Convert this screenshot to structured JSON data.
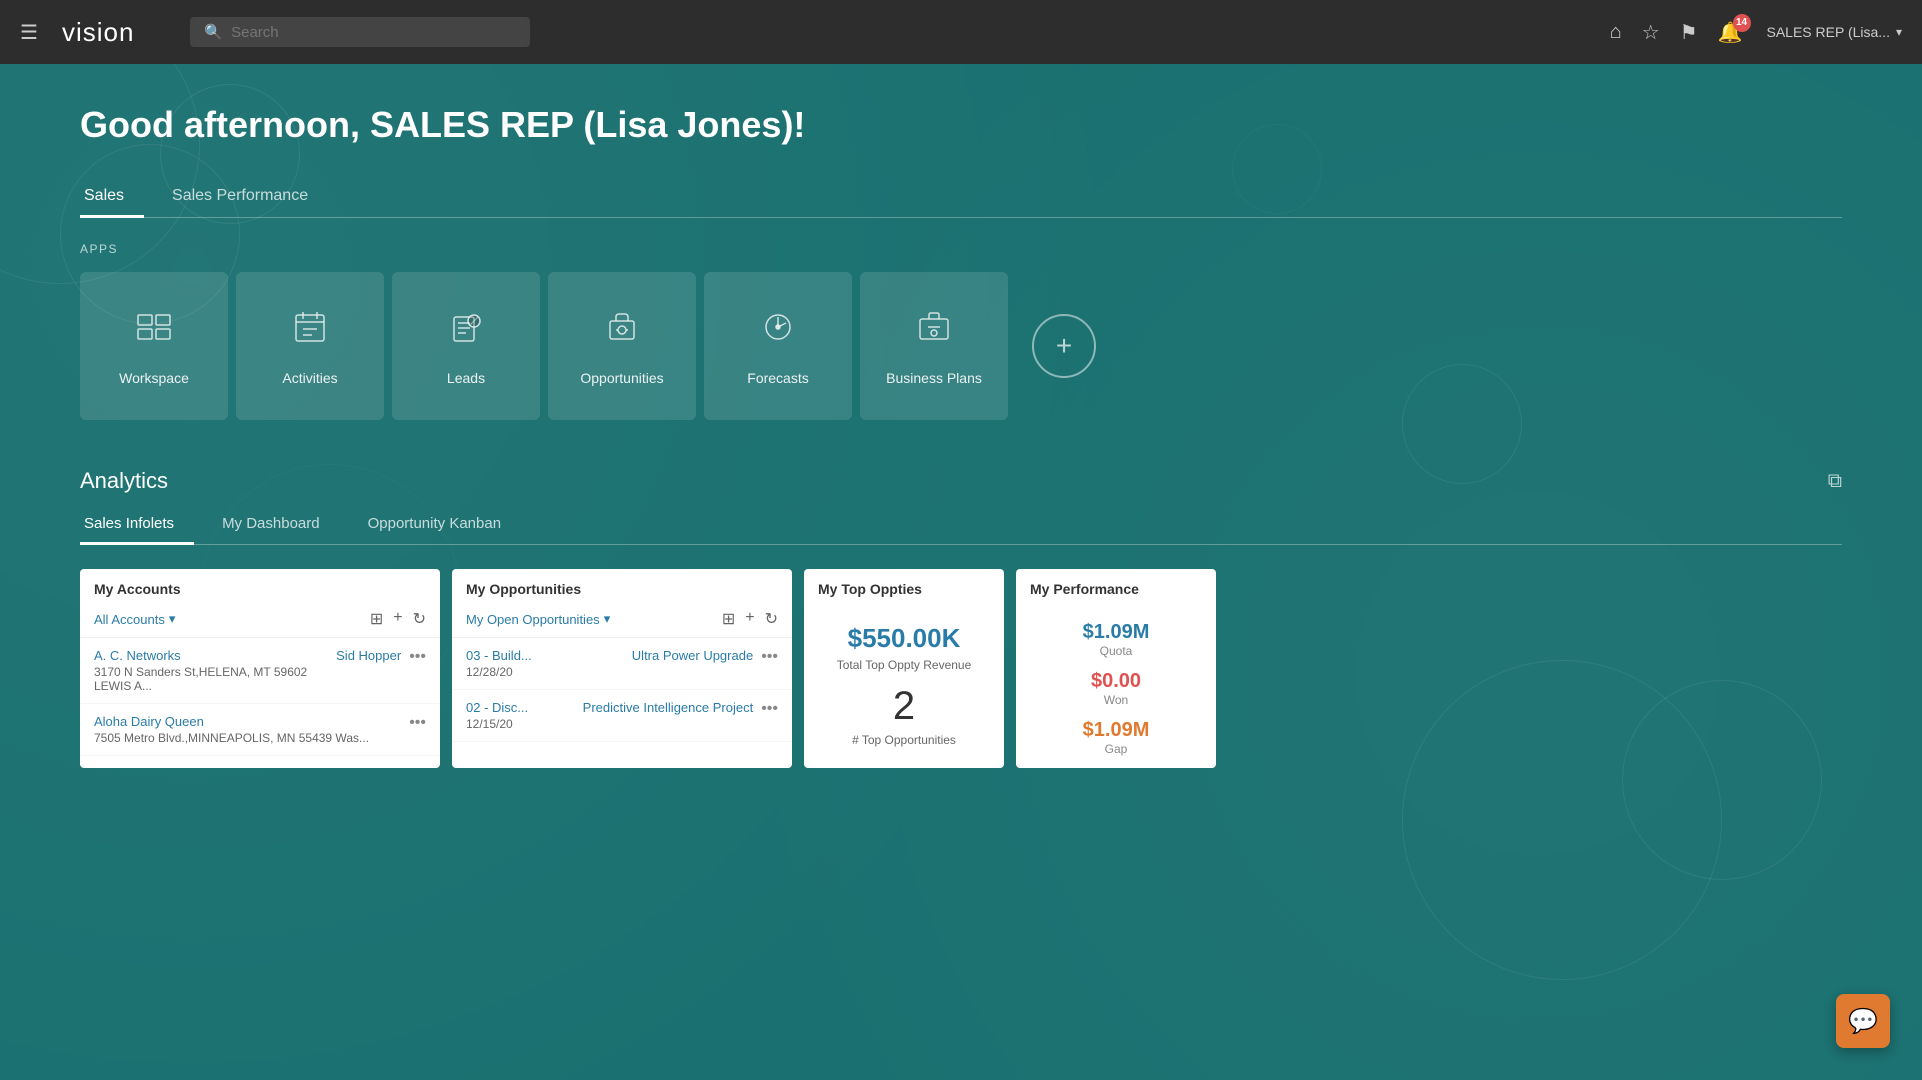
{
  "topnav": {
    "hamburger": "☰",
    "logo": "vision",
    "search_placeholder": "Search",
    "icons": {
      "home": "⌂",
      "star": "☆",
      "flag": "⚑",
      "notif": "🔔",
      "notif_count": "14"
    },
    "user_label": "SALES REP (Lisa...",
    "user_caret": "▾"
  },
  "main": {
    "greeting": "Good afternoon, SALES REP (Lisa Jones)!",
    "tabs": [
      {
        "label": "Sales",
        "active": true
      },
      {
        "label": "Sales Performance",
        "active": false
      }
    ],
    "apps_section_label": "APPS",
    "apps": [
      {
        "id": "workspace",
        "label": "Workspace",
        "icon": "workspace"
      },
      {
        "id": "activities",
        "label": "Activities",
        "icon": "activities"
      },
      {
        "id": "leads",
        "label": "Leads",
        "icon": "leads"
      },
      {
        "id": "opportunities",
        "label": "Opportunities",
        "icon": "opportunities"
      },
      {
        "id": "forecasts",
        "label": "Forecasts",
        "icon": "forecasts"
      },
      {
        "id": "business-plans",
        "label": "Business Plans",
        "icon": "business-plans"
      }
    ],
    "add_app_label": "+",
    "analytics": {
      "title": "Analytics",
      "tabs": [
        {
          "label": "Sales Infolets",
          "active": true
        },
        {
          "label": "My Dashboard",
          "active": false
        },
        {
          "label": "Opportunity Kanban",
          "active": false
        }
      ]
    },
    "infolets": {
      "my_accounts": {
        "title": "My Accounts",
        "filter_label": "All Accounts",
        "rows": [
          {
            "name": "A. C. Networks",
            "sub": "3170 N Sanders St,HELENA, MT 59602 LEWIS A...",
            "person": "Sid Hopper"
          },
          {
            "name": "Aloha Dairy Queen",
            "sub": "7505 Metro Blvd.,MINNEAPOLIS, MN 55439 Was...",
            "person": ""
          }
        ]
      },
      "my_opportunities": {
        "title": "My Opportunities",
        "filter_label": "My Open Opportunities",
        "rows": [
          {
            "stage": "03 - Build...",
            "date": "12/28/20",
            "name": "Ultra Power Upgrade"
          },
          {
            "stage": "02 - Disc...",
            "date": "12/15/20",
            "name": "Predictive Intelligence Project"
          }
        ]
      },
      "my_top_oppties": {
        "title": "My Top Oppties",
        "revenue": "$550.00K",
        "revenue_label": "Total Top Oppty Revenue",
        "count": "2",
        "count_label": "# Top Opportunities"
      },
      "my_performance": {
        "title": "My Performance",
        "quota": "$1.09M",
        "quota_label": "Quota",
        "won": "$0.00",
        "won_label": "Won",
        "gap": "$1.09M",
        "gap_label": "Gap"
      }
    }
  }
}
